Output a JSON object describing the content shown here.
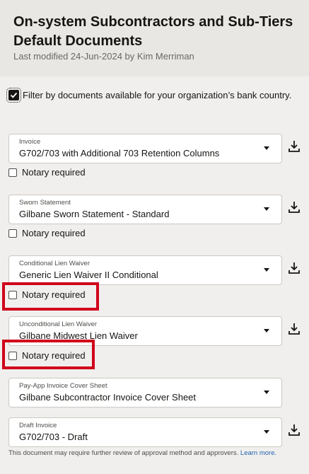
{
  "header": {
    "title": "On-system Subcontractors and Sub-Tiers Default Documents",
    "modified": "Last modified 24-Jun-2024 by Kim Merriman"
  },
  "filter": {
    "label": "Filter by documents available for your organization’s bank country.",
    "checked": true
  },
  "documents": [
    {
      "label": "Invoice",
      "value": "G702/703 with Additional 703 Retention Columns",
      "notary_label": "Notary required",
      "notary_checked": false,
      "download": true,
      "highlighted": false
    },
    {
      "label": "Sworn Statement",
      "value": "Gilbane Sworn Statement - Standard",
      "notary_label": "Notary required",
      "notary_checked": false,
      "download": true,
      "highlighted": false
    },
    {
      "label": "Conditional Lien Waiver",
      "value": "Generic Lien Waiver II Conditional",
      "notary_label": "Notary required",
      "notary_checked": false,
      "download": true,
      "highlighted": true
    },
    {
      "label": "Unconditional Lien Waiver",
      "value": "Gilbane Midwest Lien Waiver",
      "notary_label": "Notary required",
      "notary_checked": false,
      "download": true,
      "highlighted": true
    },
    {
      "label": "Pay-App Invoice Cover Sheet",
      "value": "Gilbane Subcontractor Invoice Cover Sheet",
      "download": false
    },
    {
      "label": "Draft Invoice",
      "value": "G702/703 - Draft",
      "download": true
    }
  ],
  "footer": {
    "note": "This document may require further review of approval method and approvers.",
    "link": "Learn more."
  },
  "colors": {
    "highlight": "#d0021b",
    "link": "#2265b2",
    "header_bg": "#e9e7e4",
    "page_bg": "#f1efed"
  },
  "icons": {
    "download": "download-icon",
    "dropdown": "chevron-down-icon",
    "checkbox": "checkbox-icon"
  }
}
